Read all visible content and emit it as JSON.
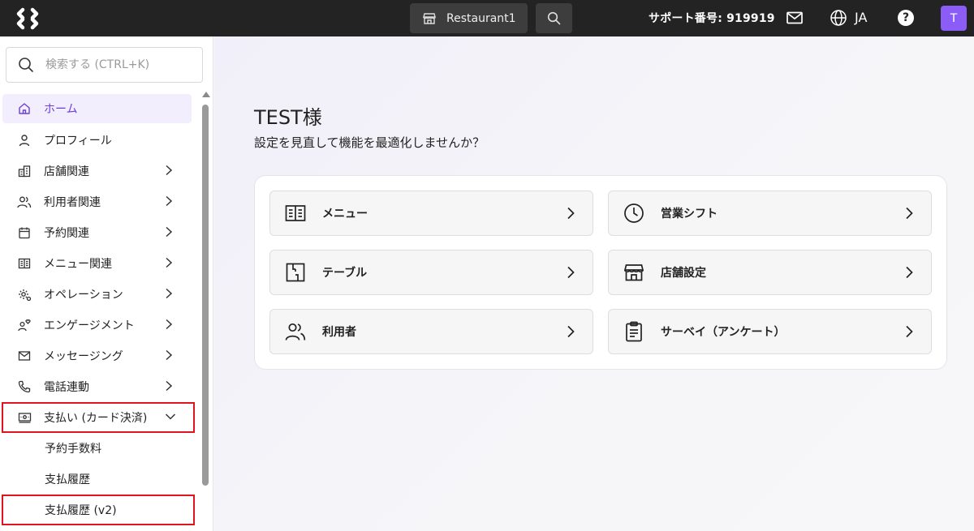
{
  "header": {
    "store_name": "Restaurant1",
    "support": "サポート番号: 919919",
    "language": "JA",
    "avatar_initial": "T",
    "help": "?"
  },
  "sidebar": {
    "search_placeholder": "検索する (CTRL+K)",
    "items": [
      {
        "label": "ホーム",
        "icon": "home-icon"
      },
      {
        "label": "プロフィール",
        "icon": "user-icon"
      },
      {
        "label": "店舗関連",
        "icon": "building-icon"
      },
      {
        "label": "利用者関連",
        "icon": "users-icon"
      },
      {
        "label": "予約関連",
        "icon": "calendar-icon"
      },
      {
        "label": "メニュー関連",
        "icon": "menu-book-icon"
      },
      {
        "label": "オペレーション",
        "icon": "operations-gear-icon"
      },
      {
        "label": "エンゲージメント",
        "icon": "engagement-icon"
      },
      {
        "label": "メッセージング",
        "icon": "mail-icon"
      },
      {
        "label": "電話連動",
        "icon": "phone-icon"
      },
      {
        "label": "支払い (カード決済)",
        "icon": "payment-card-icon"
      }
    ],
    "subitems": [
      {
        "label": "予約手数料"
      },
      {
        "label": "支払履歴"
      },
      {
        "label": "支払履歴 (v2)"
      }
    ]
  },
  "main": {
    "greeting": "TEST様",
    "subtitle": "設定を見直して機能を最適化しませんか？",
    "cards": [
      {
        "label": "メニュー",
        "icon": "menu-book-icon"
      },
      {
        "label": "営業シフト",
        "icon": "clock-icon"
      },
      {
        "label": "テーブル",
        "icon": "table-layout-icon"
      },
      {
        "label": "店舗設定",
        "icon": "store-icon"
      },
      {
        "label": "利用者",
        "icon": "users-icon"
      },
      {
        "label": "サーベイ（アンケート）",
        "icon": "clipboard-icon"
      }
    ]
  },
  "colors": {
    "topbar": "#232323",
    "accent": "#8b5cf6",
    "active_text": "#6d3fd6",
    "highlight_outline": "#e0141e"
  }
}
